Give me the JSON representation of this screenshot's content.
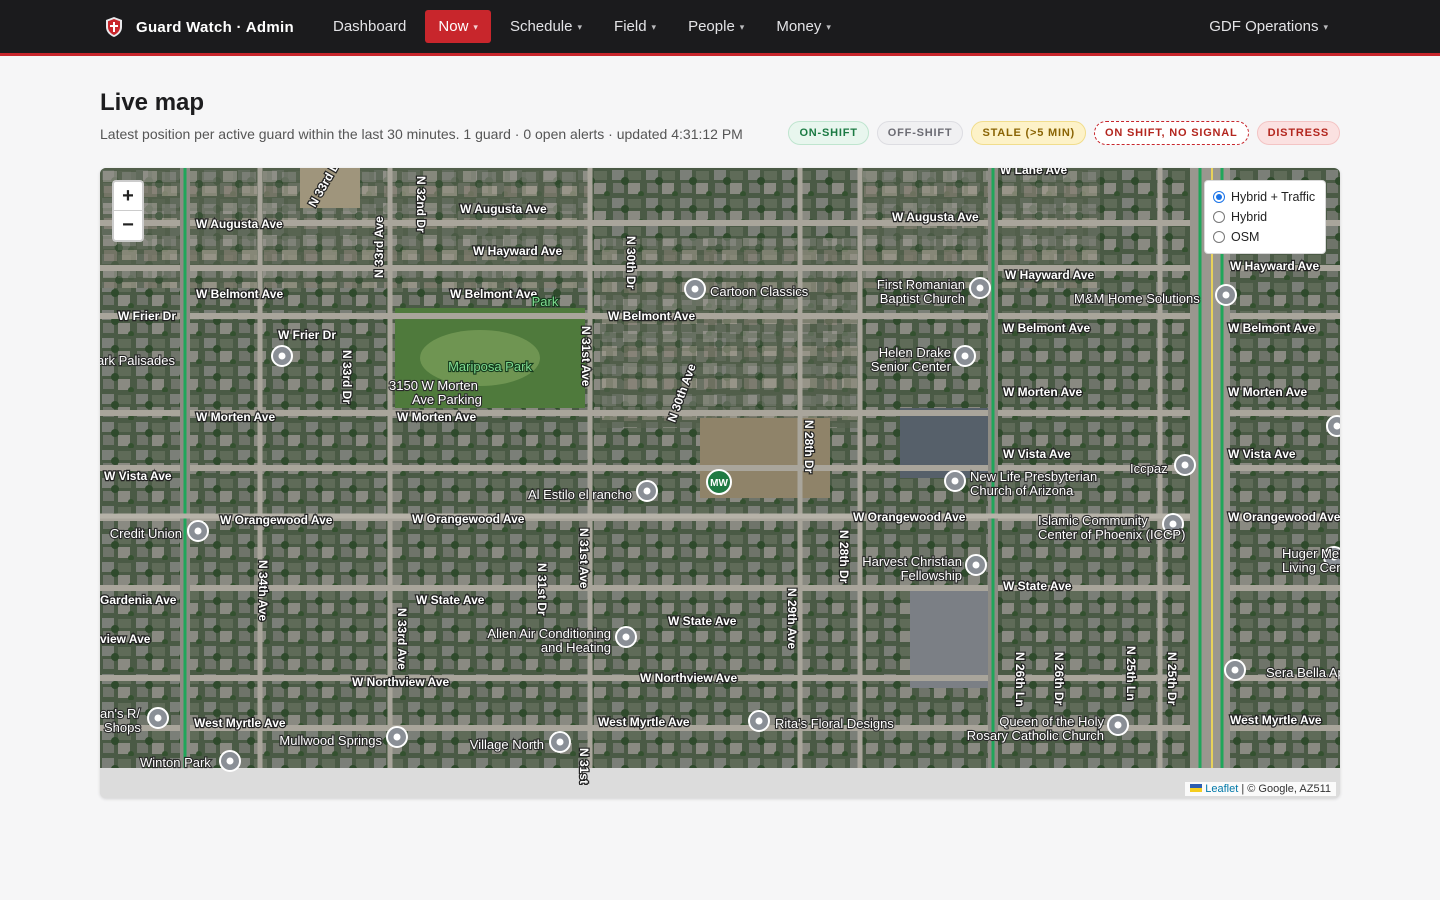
{
  "app": {
    "title": "Guard Watch · Admin"
  },
  "nav": {
    "items": [
      {
        "label": "Dashboard",
        "dropdown": false,
        "active": false
      },
      {
        "label": "Now",
        "dropdown": true,
        "active": true
      },
      {
        "label": "Schedule",
        "dropdown": true,
        "active": false
      },
      {
        "label": "Field",
        "dropdown": true,
        "active": false
      },
      {
        "label": "People",
        "dropdown": true,
        "active": false
      },
      {
        "label": "Money",
        "dropdown": true,
        "active": false
      }
    ],
    "org": "GDF Operations",
    "caret": "▾"
  },
  "page": {
    "title": "Live map",
    "subtitle": "Latest position per active guard within the last 30 minutes. 1 guard · 0 open alerts · updated 4:31:12 PM"
  },
  "legend": {
    "on_shift": "ON-SHIFT",
    "off_shift": "OFF-SHIFT",
    "stale": "STALE (>5 MIN)",
    "no_signal": "ON SHIFT, NO SIGNAL",
    "distress": "DISTRESS"
  },
  "map": {
    "zoom_in": "+",
    "zoom_out": "−",
    "layers": [
      {
        "label": "Hybrid + Traffic",
        "checked": true
      },
      {
        "label": "Hybrid",
        "checked": false
      },
      {
        "label": "OSM",
        "checked": false
      }
    ],
    "attribution": {
      "leaflet": "Leaflet",
      "rest": "| © Google, AZ511"
    },
    "guard_marker": "MW",
    "streets": [
      "W Augusta Ave",
      "W Augusta Ave",
      "W Augusta Ave",
      "W Hayward Ave",
      "W Hayward Ave",
      "W Hayward Ave",
      "W Belmont Ave",
      "W Belmont Ave",
      "W Belmont Ave",
      "W Belmont Ave",
      "W Belmont Ave",
      "W Frier Dr",
      "W Frier Dr",
      "W Morten Ave",
      "W Morten Ave",
      "W Morten Ave",
      "W Morten Ave",
      "W Vista Ave",
      "W Vista Ave",
      "W Vista Ave",
      "W Orangewood Ave",
      "W Orangewood Ave",
      "W Orangewood Ave",
      "W Orangewood Ave",
      "W State Ave",
      "W State Ave",
      "W State Ave",
      "W Northview Ave",
      "W Northview Ave",
      "West Myrtle Ave",
      "West Myrtle Ave",
      "West Myrtle Ave",
      "W Lane Ave",
      "Gardenia Ave",
      "view Ave",
      "N 32nd Dr",
      "N 33rd Dr",
      "N 33rd Ave",
      "N 33rd Dr",
      "N 30th Dr",
      "N 31st Ave",
      "N 30th Ave",
      "N 28th Dr",
      "N 28th Dr",
      "N 34th Ave",
      "N 33rd Ave",
      "N 31st Dr",
      "N 31st Ave",
      "N 29th Ave",
      "N 26th Ln",
      "N 26th Dr",
      "N 25th Ln",
      "N 25th Dr",
      "N 31st"
    ],
    "pois": [
      "Park Palisades",
      "3150 W Morten",
      "Ave Parking",
      "Cartoon Classics",
      "First Romanian",
      "Baptist Church",
      "M&M Home Solutions",
      "Helen Drake",
      "Senior Center",
      "New Life Presbyterian",
      "Church of Arizona",
      "Iccpaz",
      "Al Estilo el rancho",
      "Islamic Community",
      "Center of Phoenix (ICCP)",
      "Harvest Christian",
      "Fellowship",
      "Huger Mercy",
      "Living Center",
      "Alien Air Conditioning",
      "and Heating",
      "Sera Bella Apa",
      "Credit Union",
      "an's R/",
      "Shops",
      "Mullwood Springs",
      "Village North",
      "Rita's Floral Designs",
      "Queen of the Holy",
      "Rosary Catholic Church",
      "Winton Park"
    ],
    "parks": [
      "Mariposa Park",
      "Park"
    ]
  }
}
